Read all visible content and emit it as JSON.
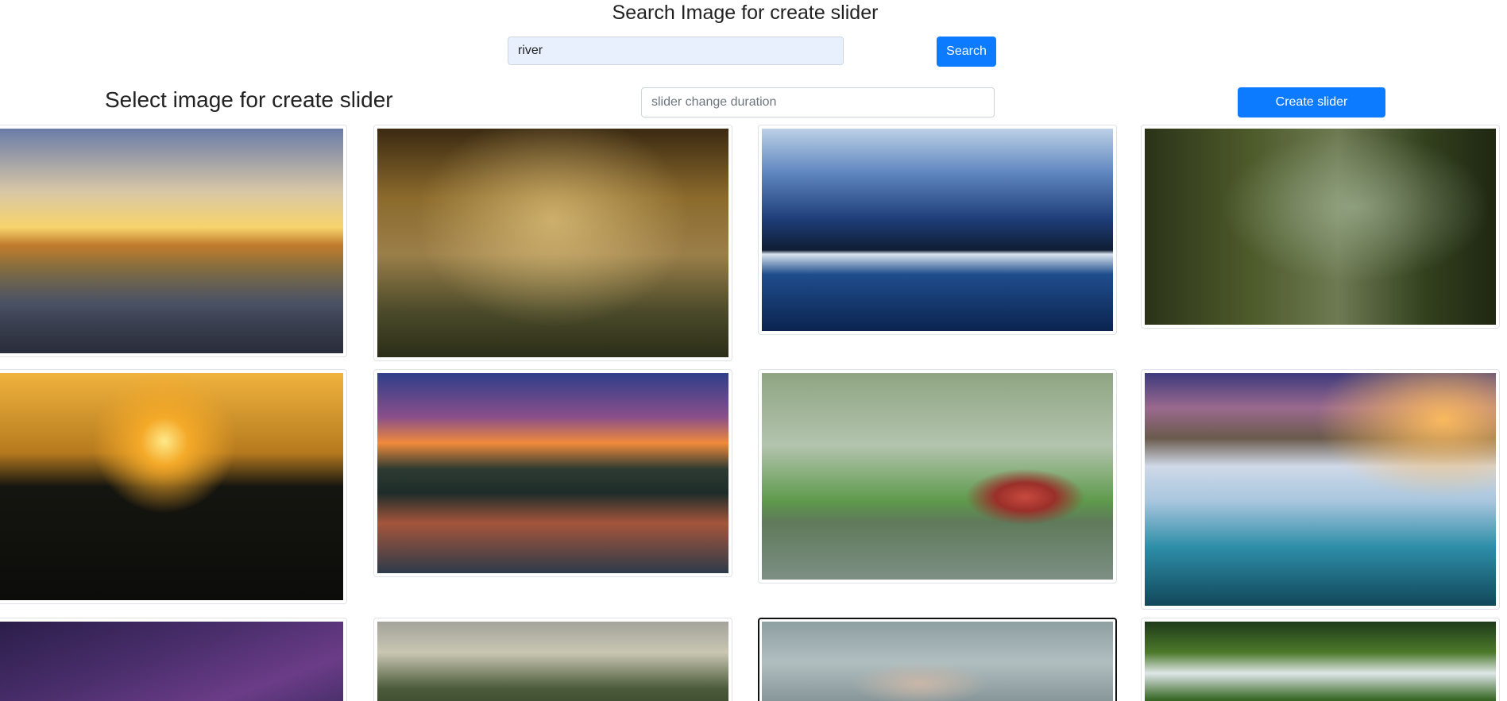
{
  "search": {
    "title": "Search Image for create slider",
    "query": "river",
    "button_label": "Search"
  },
  "slider": {
    "title": "Select image for create slider",
    "duration_placeholder": "slider change duration",
    "create_button_label": "Create slider"
  },
  "images": [
    {
      "name": "image-1",
      "selected": false
    },
    {
      "name": "image-2",
      "selected": false
    },
    {
      "name": "image-3",
      "selected": false
    },
    {
      "name": "image-4",
      "selected": false
    },
    {
      "name": "image-5",
      "selected": false
    },
    {
      "name": "image-6",
      "selected": false
    },
    {
      "name": "image-7",
      "selected": false
    },
    {
      "name": "image-8",
      "selected": false
    },
    {
      "name": "image-9",
      "selected": false
    },
    {
      "name": "image-10",
      "selected": false
    },
    {
      "name": "image-11",
      "selected": true
    },
    {
      "name": "image-12",
      "selected": false
    }
  ],
  "colors": {
    "primary": "#0d7bff",
    "search_input_bg": "#e8f0fe"
  }
}
